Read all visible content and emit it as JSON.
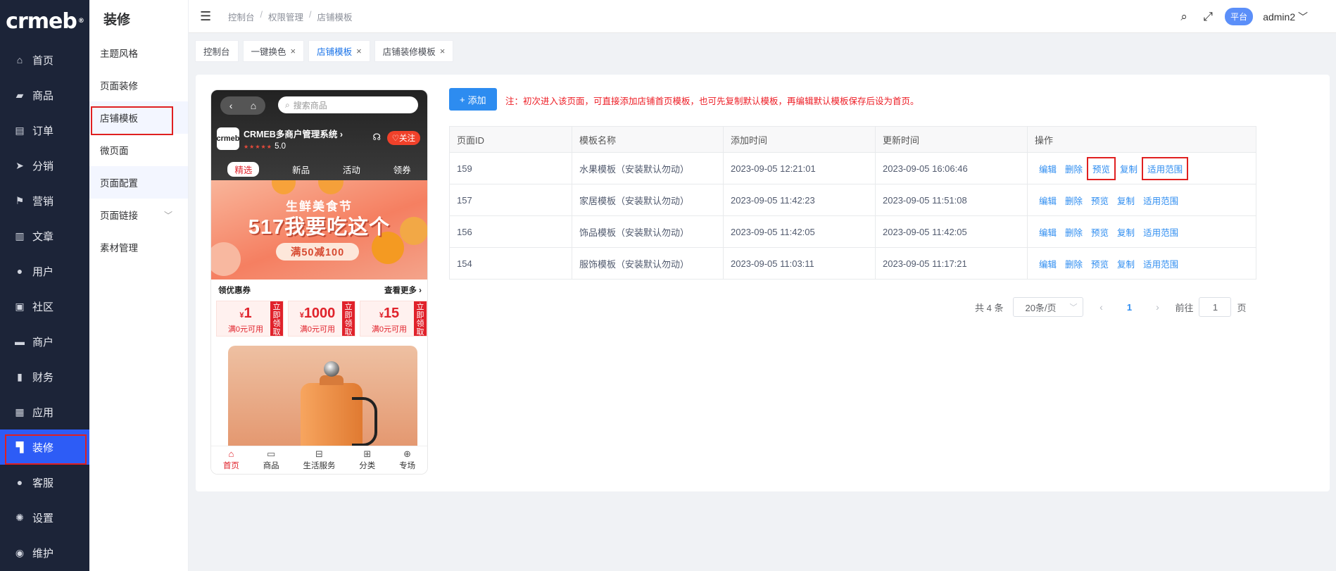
{
  "logo": "crmeb",
  "sidebar": {
    "items": [
      {
        "label": "首页",
        "icon": "home-icon"
      },
      {
        "label": "商品",
        "icon": "bag-icon"
      },
      {
        "label": "订单",
        "icon": "order-icon"
      },
      {
        "label": "分销",
        "icon": "send-icon"
      },
      {
        "label": "营销",
        "icon": "flag-icon"
      },
      {
        "label": "文章",
        "icon": "article-icon"
      },
      {
        "label": "用户",
        "icon": "user-icon"
      },
      {
        "label": "社区",
        "icon": "community-icon"
      },
      {
        "label": "商户",
        "icon": "merchant-icon"
      },
      {
        "label": "财务",
        "icon": "finance-icon"
      },
      {
        "label": "应用",
        "icon": "apps-icon"
      },
      {
        "label": "装修",
        "icon": "decorate-icon"
      },
      {
        "label": "客服",
        "icon": "service-icon"
      },
      {
        "label": "设置",
        "icon": "gear-icon"
      },
      {
        "label": "维护",
        "icon": "maintain-icon"
      }
    ],
    "active": "装修"
  },
  "submenu": {
    "title": "装修",
    "items": [
      "主题风格",
      "页面装修",
      "店铺模板",
      "微页面",
      "页面配置",
      "页面链接",
      "素材管理"
    ],
    "active": "店铺模板"
  },
  "header": {
    "breadcrumb": [
      "控制台",
      "权限管理",
      "店铺模板"
    ],
    "platform_badge": "平台",
    "user": "admin2"
  },
  "tags": [
    {
      "label": "控制台",
      "closable": false
    },
    {
      "label": "一键换色",
      "closable": true
    },
    {
      "label": "店铺模板",
      "closable": true,
      "active": true
    },
    {
      "label": "店铺装修模板",
      "closable": true
    }
  ],
  "phone": {
    "search_placeholder": "搜索商品",
    "shop_name": "CRMEB多商户管理系统",
    "rating": "5.0",
    "follow": "关注",
    "tabs": [
      "精选",
      "新品",
      "活动",
      "领券"
    ],
    "banner_sub": "生鲜美食节",
    "banner_main": "517我要吃这个",
    "banner_pill": "满50减100",
    "coupon_title": "领优惠券",
    "coupon_more": "查看更多",
    "coupons": [
      {
        "amount": "1",
        "cond": "满0元可用",
        "get": "立即领取"
      },
      {
        "amount": "1000",
        "cond": "满0元可用",
        "get": "立即领取"
      },
      {
        "amount": "15",
        "cond": "满0元可用",
        "get": "立即领取"
      }
    ],
    "footer": [
      "首页",
      "商品",
      "生活服务",
      "分类",
      "专场"
    ]
  },
  "main": {
    "add_button": "添加",
    "note": "注：初次进入该页面，可直接添加店铺首页模板，也可先复制默认模板，再编辑默认模板保存后设为首页。",
    "columns": [
      "页面ID",
      "模板名称",
      "添加时间",
      "更新时间",
      "操作"
    ],
    "rows": [
      {
        "id": "159",
        "name": "水果模板（安装默认勿动）",
        "added": "2023-09-05 12:21:01",
        "updated": "2023-09-05 16:06:46"
      },
      {
        "id": "157",
        "name": "家居模板（安装默认勿动）",
        "added": "2023-09-05 11:42:23",
        "updated": "2023-09-05 11:51:08"
      },
      {
        "id": "156",
        "name": "饰品模板（安装默认勿动）",
        "added": "2023-09-05 11:42:05",
        "updated": "2023-09-05 11:42:05"
      },
      {
        "id": "154",
        "name": "服饰模板（安装默认勿动）",
        "added": "2023-09-05 11:03:11",
        "updated": "2023-09-05 11:17:21"
      }
    ],
    "actions": [
      "编辑",
      "删除",
      "预览",
      "复制",
      "适用范围"
    ]
  },
  "pagination": {
    "total": "共 4 条",
    "page_size": "20条/页",
    "current": "1",
    "goto_prefix": "前往",
    "goto_value": "1",
    "goto_suffix": "页"
  },
  "colors": {
    "sidebar": "#1c2438",
    "primary": "#2d8cf0",
    "highlight": "#e02020"
  }
}
